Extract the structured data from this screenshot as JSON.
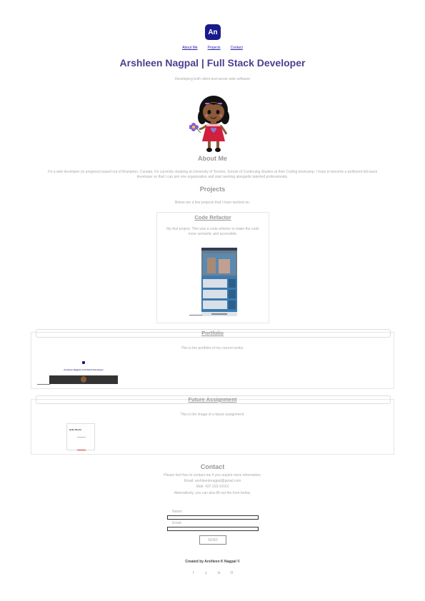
{
  "header": {
    "logo_text": "An",
    "nav": [
      "About Me",
      "Projects",
      "Contact"
    ]
  },
  "hero": {
    "title": "Arshleen Nagpal | Full Stack Developer",
    "subtitle": "Developing both client and server-side software"
  },
  "about": {
    "heading": "About Me",
    "text_line1": "I'm a web developer (in progress) based out of Brampton, Canada. I'm currently studying at University of Toronto, School of Continuing Studies at their Coding bootcamp. I hope to become a proficient full-stack",
    "text_line2": "developer so that I can join one organization and start working alongside talented professionals."
  },
  "projects": {
    "heading": "Projects",
    "intro": "Below are a few projects that I have worked on.",
    "items": [
      {
        "title": "Code Refactor",
        "desc_line1": "My first project. This was a code refactor to make the code",
        "desc_line2": "more semantic and accessible."
      },
      {
        "title": "Portfolio",
        "desc_line1": "This is the portfolio of my current works.",
        "thumb_title": "Arshleen Nagpal | Full Stack Developer"
      },
      {
        "title": "Future Assignment",
        "desc_line1": "This is the image of a future assignment.",
        "thumb_title": "Hello World"
      }
    ]
  },
  "contact": {
    "heading": "Contact",
    "line1": "Please feel free to contact me if you require more information.",
    "line2": "Email: arshleenknagpal@gmail.com",
    "line3": "Mob: 437-223-XXXX",
    "line4": "Alternatively, you can also fill out the form below.",
    "name_label": "Name:",
    "email_label": "Email:",
    "send_label": "SEND"
  },
  "footer": {
    "credit": "Created by Arshleen K Nagpal ©",
    "social_icons": [
      "facebook-icon",
      "twitter-icon",
      "linkedin-icon",
      "github-icon"
    ],
    "social_glyphs": [
      "f",
      "y",
      "in",
      "O"
    ]
  }
}
